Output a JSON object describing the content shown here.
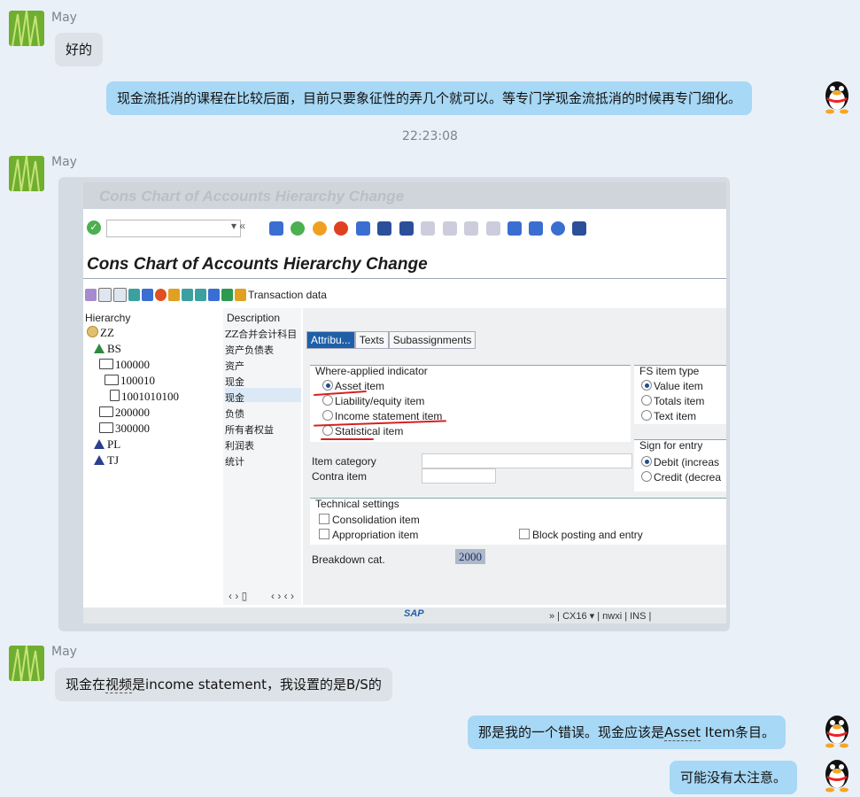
{
  "messages": [
    {
      "sender": "May",
      "text": "好的"
    },
    {
      "text": "现金流抵消的课程在比较后面，目前只要象征性的弄几个就可以。等专门学现金流抵消的时候再专门细化。"
    },
    {
      "timestamp": "22:23:08"
    },
    {
      "sender": "May"
    },
    {
      "sender": "May",
      "text_parts": [
        "现金在",
        "视频",
        "是income statement，我设置的是B/S的"
      ]
    },
    {
      "text_parts": [
        "那是我的一个错误。现金应该是",
        "Asset",
        " Item条目。"
      ]
    },
    {
      "text": "可能没有太注意。"
    }
  ],
  "sap": {
    "window_title": "Cons Chart of Accounts Hierarchy Change",
    "app_title": "Cons Chart of Accounts Hierarchy Change",
    "nav_arrows": "▾ «",
    "transaction_label": "Transaction data",
    "tree": {
      "col_hierarchy": "Hierarchy",
      "col_description": "Description",
      "nodes": [
        {
          "label": "ZZ",
          "desc": "ZZ合并会计科目"
        },
        {
          "label": "BS",
          "desc": "资产负债表"
        },
        {
          "label": "100000",
          "desc": "资产"
        },
        {
          "label": "100010",
          "desc": "现金"
        },
        {
          "label": "1001010100",
          "desc": "现金"
        },
        {
          "label": "200000",
          "desc": "负债"
        },
        {
          "label": "300000",
          "desc": "所有者权益"
        },
        {
          "label": "PL",
          "desc": "利润表"
        },
        {
          "label": "TJ",
          "desc": "统计"
        }
      ],
      "nav1": "‹ › ▯",
      "nav2": "‹ › ‹ ›"
    },
    "tabs": [
      "Attribu...",
      "Texts",
      "Subassignments"
    ],
    "where_applied": {
      "title": "Where-applied indicator",
      "options": [
        "Asset item",
        "Liability/equity item",
        "Income statement item",
        "Statistical item"
      ],
      "selected": "Asset item"
    },
    "fs_item_type": {
      "title": "FS item type",
      "options": [
        "Value item",
        "Totals item",
        "Text item"
      ],
      "selected": "Value item"
    },
    "sign_for_entry": {
      "title": "Sign for entry",
      "options": [
        "Debit (increas",
        "Credit (decrea"
      ],
      "selected": "Debit (increas"
    },
    "item_category_label": "Item category",
    "contra_item_label": "Contra item",
    "technical": {
      "title": "Technical settings",
      "checks": [
        "Consolidation item",
        "Appropriation item",
        "Block posting and entry"
      ]
    },
    "breakdown_label": "Breakdown cat.",
    "breakdown_value": "2000",
    "status": {
      "brand": "SAP",
      "text": "» | CX16 ▾ | nwxi | INS |"
    },
    "colors": {
      "selected_tab": "#1f5fa8",
      "annotation": "#d62020",
      "out_bubble": "#a7d8f5",
      "in_bubble": "#dde2e8"
    }
  }
}
